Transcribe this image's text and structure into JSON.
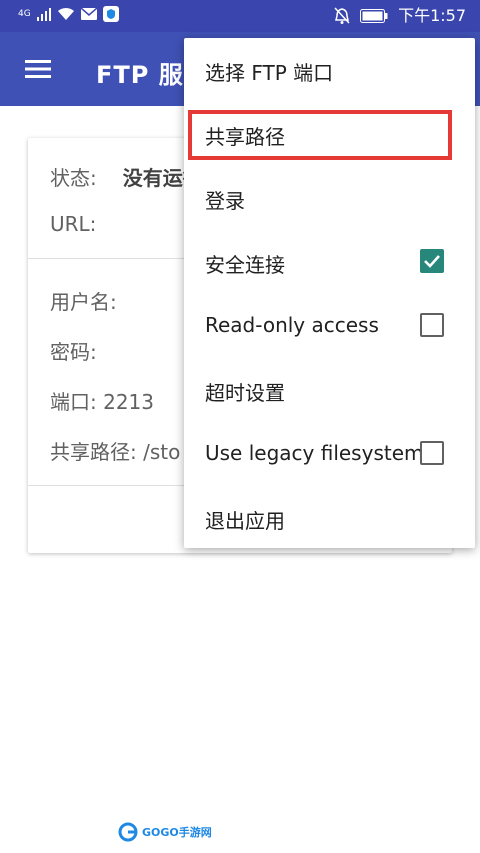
{
  "status_bar": {
    "network_type": "4G",
    "time": "下午1:57"
  },
  "app_bar": {
    "title": "FTP 服务器"
  },
  "card": {
    "status_label": "状态:",
    "status_value": "没有运行",
    "url_label": "URL:",
    "username_label": "用户名:",
    "password_label": "密码:",
    "port_label": "端口: 2213",
    "share_path_label": "共享路径: /sto"
  },
  "menu": {
    "items": [
      {
        "label": "选择 FTP 端口"
      },
      {
        "label": "共享路径"
      },
      {
        "label": "登录"
      },
      {
        "label": "安全连接",
        "checked": true
      },
      {
        "label": "Read-only access",
        "checked": false
      },
      {
        "label": "超时设置"
      },
      {
        "label": "Use legacy filesystem",
        "checked": false
      },
      {
        "label": "退出应用"
      }
    ]
  },
  "colors": {
    "status_bar": "#3a46ad",
    "app_bar": "#3f51b5",
    "checkbox_checked": "#26877a",
    "highlight_box": "#e53935"
  },
  "watermark": {
    "text": "GOGO手游网"
  }
}
